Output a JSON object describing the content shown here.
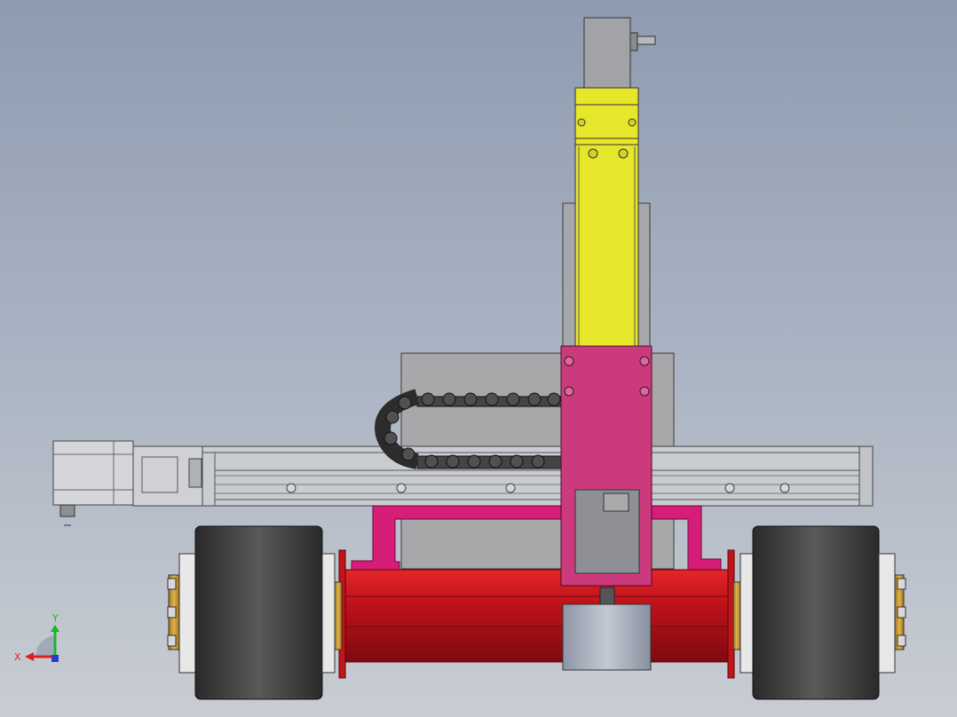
{
  "colors": {
    "background_top": "#8e9bb0",
    "background_bottom": "#c9cdd3",
    "z_axis_yellow": "#e6e62a",
    "carriage_magenta": "#cc3a7e",
    "bracket_magenta": "#d61e78",
    "body_red": "#c4141a",
    "wheel_dark": "#3a3a3a",
    "rail_gray": "#c9ccd1",
    "chain_dark": "#333333",
    "x_axis_red": "#e0201c",
    "y_axis_green": "#19b52c"
  },
  "triad": {
    "x_label": "X",
    "y_label": "Y"
  }
}
